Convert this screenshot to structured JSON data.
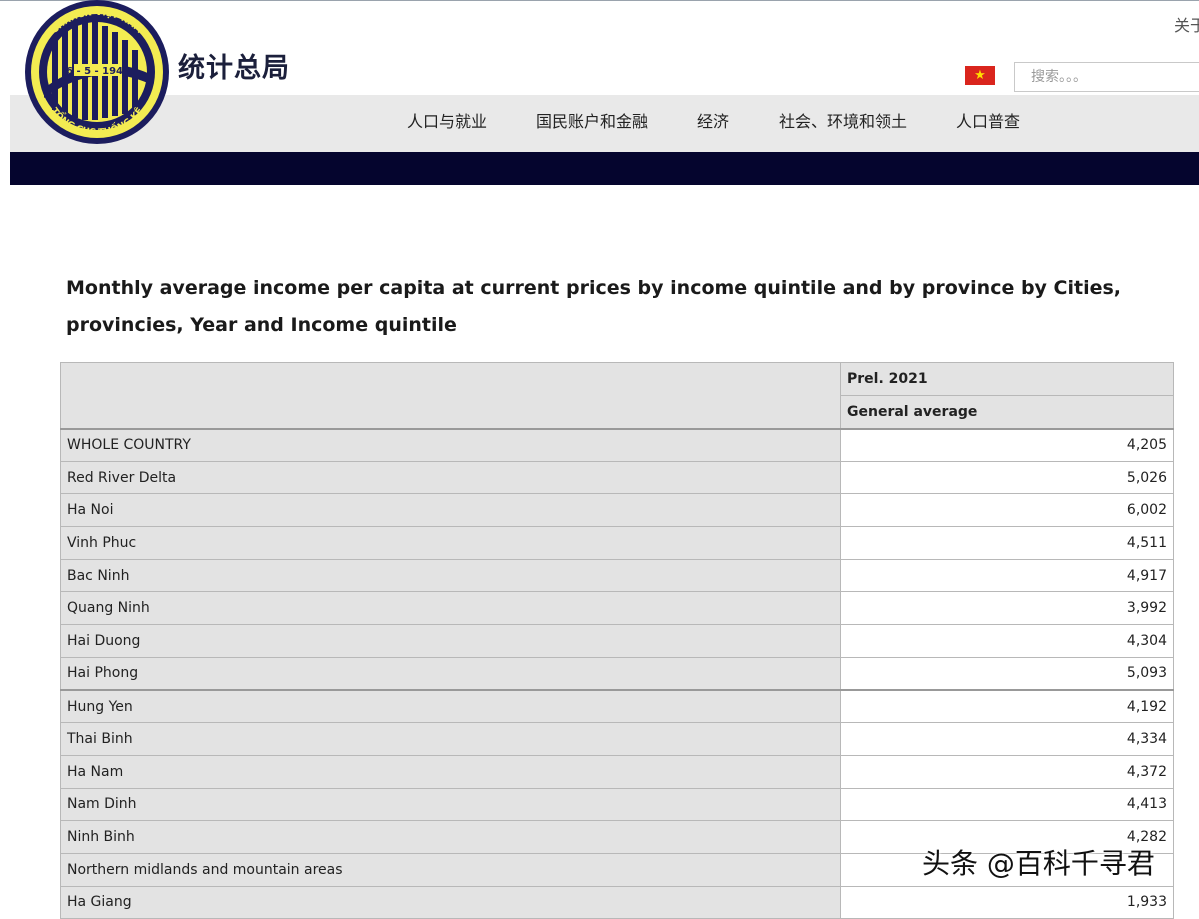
{
  "header": {
    "corner_link": "关于",
    "brand_title": "统计总局",
    "search_placeholder": "搜索。。。",
    "logo": {
      "top_text": "CHXHCN VIỆT NAM",
      "date_text": "6 - 5 - 1946",
      "bottom_text": "TỔNG CỤC THỐNG KÊ"
    },
    "flag_icon": "vietnam-flag-icon"
  },
  "nav": {
    "items": [
      {
        "label": "人口与就业"
      },
      {
        "label": "国民账户和金融"
      },
      {
        "label": "经济"
      },
      {
        "label": "社会、环境和领土"
      },
      {
        "label": "人口普查"
      }
    ]
  },
  "table": {
    "title": "Monthly average income per capita at current prices by income quintile and by province by Cities, provincies, Year and Income quintile",
    "col_year": "Prel. 2021",
    "col_quintile": "General average",
    "rows": [
      {
        "label": "WHOLE COUNTRY",
        "value": "4,205"
      },
      {
        "label": "Red River Delta",
        "value": "5,026"
      },
      {
        "label": "Ha Noi",
        "value": "6,002"
      },
      {
        "label": "Vinh Phuc",
        "value": "4,511"
      },
      {
        "label": "Bac Ninh",
        "value": "4,917"
      },
      {
        "label": "Quang Ninh",
        "value": "3,992"
      },
      {
        "label": "Hai Duong",
        "value": "4,304"
      },
      {
        "label": "Hai Phong",
        "value": "5,093"
      },
      {
        "label": "Hung Yen",
        "value": "4,192"
      },
      {
        "label": "Thai Binh",
        "value": "4,334"
      },
      {
        "label": "Ha Nam",
        "value": "4,372"
      },
      {
        "label": "Nam Dinh",
        "value": "4,413"
      },
      {
        "label": "Ninh Binh",
        "value": "4,282"
      },
      {
        "label": "Northern midlands and mountain areas",
        "value": ""
      },
      {
        "label": "Ha Giang",
        "value": "1,933"
      }
    ]
  },
  "watermark": "头条 @百科千寻君",
  "colors": {
    "dark_band": "#05052e",
    "nav_bg": "#e9e9e9",
    "logo_navy": "#1c1d5e",
    "logo_yellow": "#f3ec52",
    "header_cell_bg": "#e3e3e3"
  }
}
